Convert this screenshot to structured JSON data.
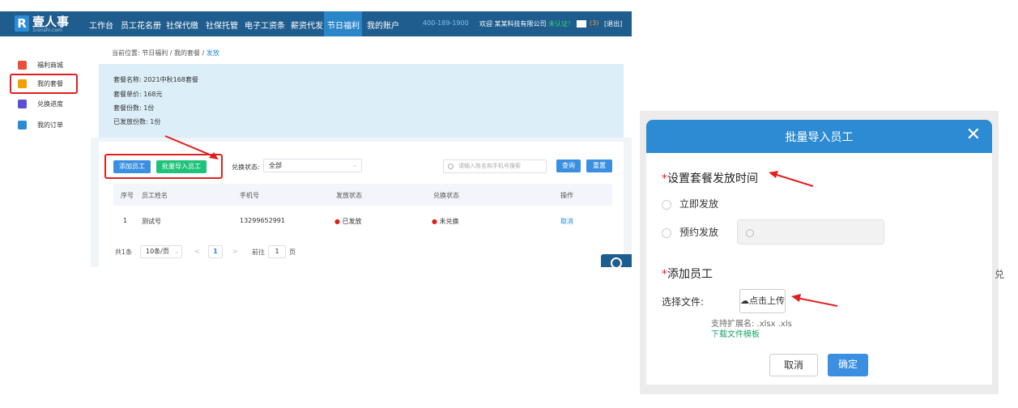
{
  "app": {
    "logo_mark": "R",
    "logo_text": "壹人事",
    "logo_sub": "1renshi.com"
  },
  "nav": {
    "items": [
      "工作台",
      "员工花名册",
      "社保代缴",
      "社保托管",
      "电子工资条",
      "薪资代发",
      "节日福利",
      "我的账户"
    ],
    "active": "节日福利",
    "phone": "400-189-1900",
    "welcome": "欢迎",
    "company": "某某科技有限公司",
    "unverified": "未认证！",
    "mail_count": "(3)",
    "logout": "[退出]"
  },
  "sidebar": {
    "items": [
      {
        "label": "福利商城",
        "icon": "shop-icon",
        "color": "#e8503a"
      },
      {
        "label": "我的套餐",
        "icon": "gift-icon",
        "color": "#f0a000"
      },
      {
        "label": "兑换进度",
        "icon": "hourglass-icon",
        "color": "#5c4fd6"
      },
      {
        "label": "我的订单",
        "icon": "order-icon",
        "color": "#2c8bd6"
      }
    ]
  },
  "breadcrumb": {
    "prefix": "当前位置:",
    "path1": "节日福利",
    "sep": "/",
    "path2": "我的套餐",
    "current": "发放"
  },
  "package_info": {
    "name": "套餐名称: 2021中秋168套餐",
    "unit_price": "套餐单价: 168元",
    "count": "套餐份数: 1份",
    "issued": "已发放份数: 1份"
  },
  "toolbar": {
    "add_employee": "添加员工",
    "batch_import": "批量导入员工",
    "status_label": "兑换状态:",
    "status_value": "全部",
    "search_placeholder": "请输入姓名和手机号搜索",
    "query": "查询",
    "reset": "重置"
  },
  "table": {
    "headers": [
      "序号",
      "员工姓名",
      "手机号",
      "发放状态",
      "兑换状态",
      "操作"
    ],
    "rows": [
      {
        "index": "1",
        "name": "测试号",
        "phone": "13299652991",
        "issue_status": "已发放",
        "redeem_status": "未兑换",
        "action": "取消"
      }
    ]
  },
  "pagination": {
    "total": "共1条",
    "page_size": "10条/页",
    "prev": "<",
    "current": "1",
    "next": ">",
    "goto_prefix": "前往",
    "goto_value": "1",
    "goto_suffix": "页"
  },
  "dialog": {
    "title": "批量导入员工",
    "close": "✕",
    "section1": "设置套餐发放时间",
    "option_now": "立即发放",
    "option_schedule": "预约发放",
    "section2": "添加员工",
    "file_label": "选择文件:",
    "upload": "点击上传",
    "hint": "支持扩展名: .xlsx .xls",
    "template_link": "下载文件模板",
    "cancel": "取消",
    "confirm": "确定",
    "star": "*"
  },
  "edge_text": "兑",
  "colors": {
    "topbar": "#1f5d8e",
    "accent": "#2c8bd6",
    "green": "#1ea36a",
    "annotation": "#e02020"
  }
}
